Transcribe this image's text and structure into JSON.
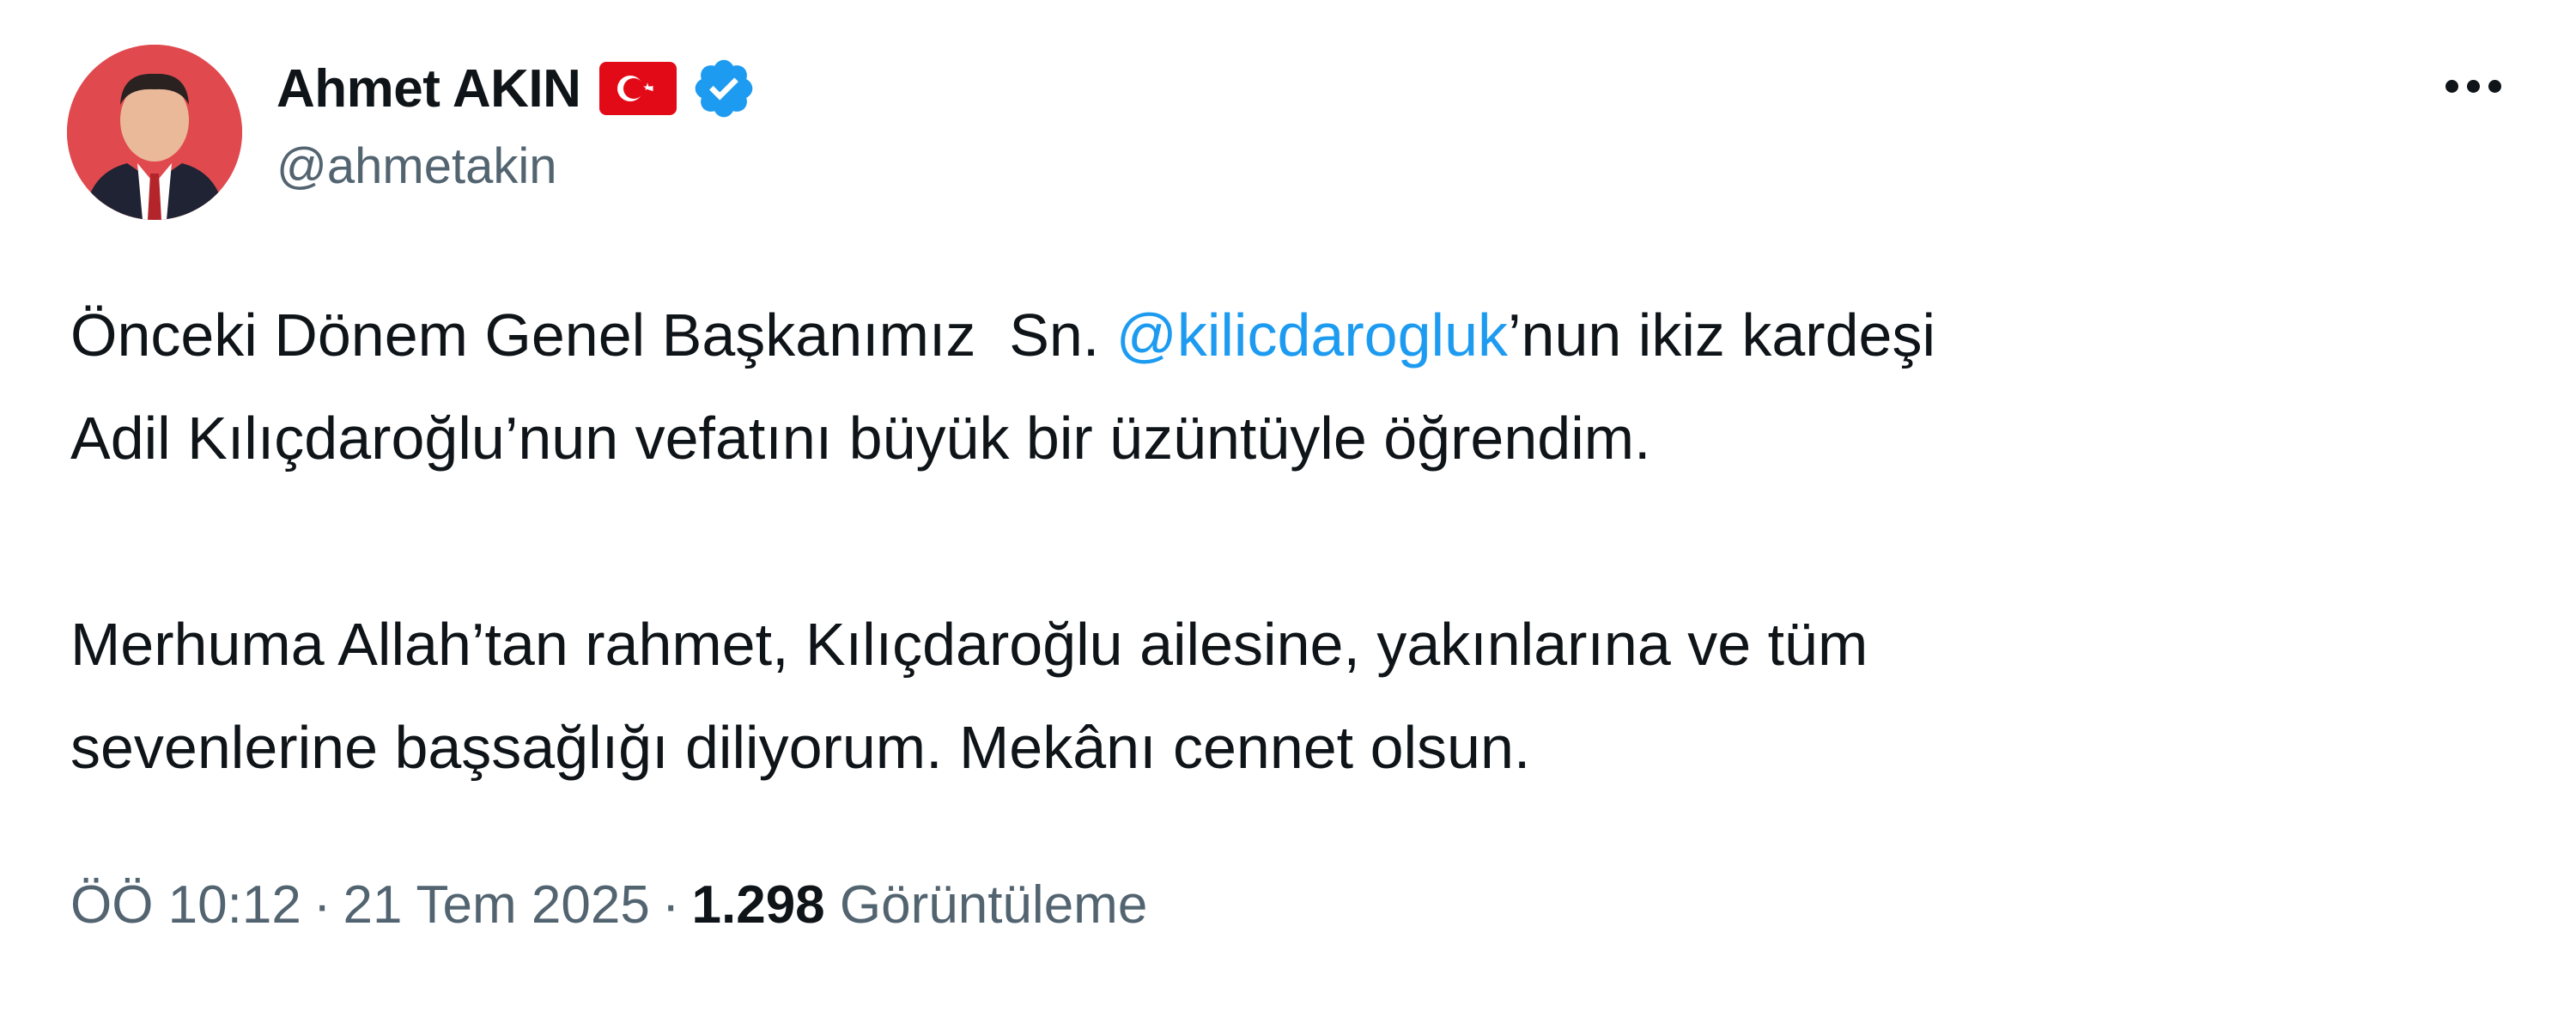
{
  "author": {
    "display_name": "Ahmet AKIN",
    "handle": "@ahmetakin",
    "flag_icon": "turkey-flag-icon",
    "verified_icon": "verified-badge-icon",
    "verified_color": "#1d9bf0"
  },
  "more_icon": "more-horizontal-icon",
  "tweet": {
    "p1_before": "Önceki Dönem Genel Başkanımız  Sn. ",
    "p1_mention": "@kilicdarogluk",
    "p1_after": "’nun ikiz kardeşi",
    "p1_line2": "Adil Kılıçdaroğlu’nun vefatını büyük bir üzüntüyle öğrendim.",
    "p2_line1": "Merhuma Allah’tan rahmet, Kılıçdaroğlu ailesine, yakınlarına ve tüm",
    "p2_line2": "sevenlerine başsağlığı diliyorum. Mekânı cennet olsun."
  },
  "meta": {
    "time": "ÖÖ 10:12",
    "separator": "·",
    "date": "21 Tem 2025",
    "views_count": "1.298",
    "views_label": "Görüntüleme"
  },
  "colors": {
    "text": "#0f1419",
    "secondary": "#536471",
    "link": "#1d9bf0"
  }
}
